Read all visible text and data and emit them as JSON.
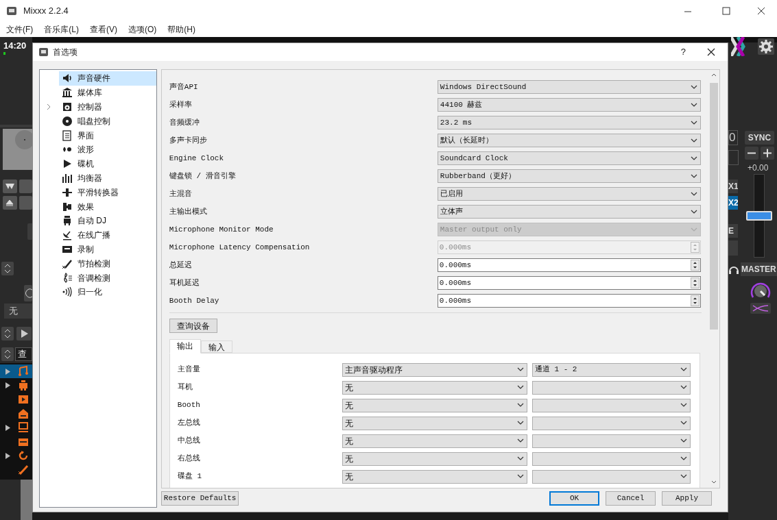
{
  "window": {
    "title": "Mixxx 2.2.4",
    "menu": [
      "文件(F)",
      "音乐库(L)",
      "查看(V)",
      "选项(O)",
      "帮助(H)"
    ]
  },
  "background_app": {
    "clock": "14:20",
    "effect_select": "无",
    "search_field": "查",
    "library_tree": [
      {
        "expandable": true,
        "selected": true
      },
      {
        "expandable": true,
        "selected": false
      },
      {
        "expandable": false,
        "selected": false
      },
      {
        "expandable": false,
        "selected": false
      },
      {
        "expandable": true,
        "selected": false
      },
      {
        "expandable": false,
        "selected": false
      },
      {
        "expandable": true,
        "selected": false
      },
      {
        "expandable": false,
        "selected": false
      }
    ],
    "top_digit": "0",
    "sync": "SYNC",
    "rate": "+0.00",
    "rate_slider": {
      "level": 0.5
    },
    "fx_buttons": [
      {
        "label": "X1",
        "selected": false
      },
      {
        "label": "X2",
        "selected": true
      }
    ],
    "fx_label": "E",
    "master": "MASTER"
  },
  "dialog": {
    "title": "首选项",
    "help": "?",
    "sidebar": [
      {
        "label": "声音硬件",
        "selected": true,
        "expandable": false
      },
      {
        "label": "媒体库",
        "selected": false,
        "expandable": false
      },
      {
        "label": "控制器",
        "selected": false,
        "expandable": true
      },
      {
        "label": "唱盘控制",
        "selected": false,
        "expandable": false
      },
      {
        "label": "界面",
        "selected": false,
        "expandable": false
      },
      {
        "label": "波形",
        "selected": false,
        "expandable": false
      },
      {
        "label": "碟机",
        "selected": false,
        "expandable": false
      },
      {
        "label": "均衡器",
        "selected": false,
        "expandable": false
      },
      {
        "label": "平滑转换器",
        "selected": false,
        "expandable": false
      },
      {
        "label": "效果",
        "selected": false,
        "expandable": false
      },
      {
        "label": "自动 DJ",
        "selected": false,
        "expandable": false
      },
      {
        "label": "在线广播",
        "selected": false,
        "expandable": false
      },
      {
        "label": "录制",
        "selected": false,
        "expandable": false
      },
      {
        "label": "节拍检测",
        "selected": false,
        "expandable": false
      },
      {
        "label": "音调检测",
        "selected": false,
        "expandable": false
      },
      {
        "label": "归一化",
        "selected": false,
        "expandable": false
      }
    ],
    "settings": [
      {
        "label": "声音API",
        "kind": "combo",
        "value": "Windows DirectSound",
        "disabled": false
      },
      {
        "label": "采样率",
        "kind": "combo",
        "value": "44100 赫兹",
        "disabled": false
      },
      {
        "label": "音频缓冲",
        "kind": "combo",
        "value": "23.2 ms",
        "disabled": false
      },
      {
        "label": "多声卡同步",
        "kind": "combo",
        "value": "默认（长延时）",
        "disabled": false
      },
      {
        "label": "Engine Clock",
        "kind": "combo",
        "value": "Soundcard Clock",
        "disabled": false
      },
      {
        "label": "键盘锁 / 滑音引擎",
        "kind": "combo",
        "value": "Rubberband（更好）",
        "disabled": false
      },
      {
        "label": "主混音",
        "kind": "combo",
        "value": "已启用",
        "disabled": false
      },
      {
        "label": "主输出模式",
        "kind": "combo",
        "value": "立体声",
        "disabled": false
      },
      {
        "label": "Microphone Monitor Mode",
        "kind": "combo",
        "value": "Master output only",
        "disabled": true
      },
      {
        "label": "Microphone Latency Compensation",
        "kind": "spin",
        "value": "0.000ms",
        "disabled": true
      },
      {
        "label": "总延迟",
        "kind": "spin",
        "value": "0.000ms",
        "disabled": false
      },
      {
        "label": "耳机延迟",
        "kind": "spin",
        "value": "0.000ms",
        "disabled": false
      },
      {
        "label": "Booth Delay",
        "kind": "spin",
        "value": "0.000ms",
        "disabled": false
      }
    ],
    "query_button": "查询设备",
    "tabs": [
      {
        "label": "输出",
        "selected": true
      },
      {
        "label": "输入",
        "selected": false
      }
    ],
    "outputs": [
      {
        "label": "主音量",
        "device": "主声音驱动程序",
        "channel": "通道 1 - 2"
      },
      {
        "label": "耳机",
        "device": "无"
      },
      {
        "label": "Booth",
        "device": "无"
      },
      {
        "label": "左总线",
        "device": "无"
      },
      {
        "label": "中总线",
        "device": "无"
      },
      {
        "label": "右总线",
        "device": "无"
      },
      {
        "label": "碟盘 1",
        "device": "无"
      }
    ],
    "buttons": [
      {
        "label": "Restore Defaults",
        "kind": "left",
        "default": false
      },
      {
        "label": "OK",
        "kind": "right",
        "default": true
      },
      {
        "label": "Cancel",
        "kind": "right",
        "default": false
      },
      {
        "label": "Apply",
        "kind": "right",
        "default": false
      }
    ]
  }
}
